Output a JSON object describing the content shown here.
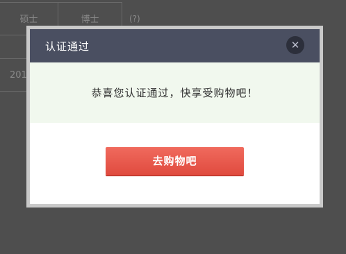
{
  "background": {
    "cells": [
      "硕士",
      "博士",
      "201"
    ],
    "note": "(?)"
  },
  "modal": {
    "title": "认证通过",
    "close_icon": "close-icon",
    "close_glyph": "✕",
    "message": "恭喜您认证通过，快享受购物吧！",
    "button_label": "去购物吧"
  },
  "colors": {
    "overlay": "#4e4e4e",
    "header": "#4a4f61",
    "message_band": "#f1f8ee",
    "button": "#e8554a"
  }
}
